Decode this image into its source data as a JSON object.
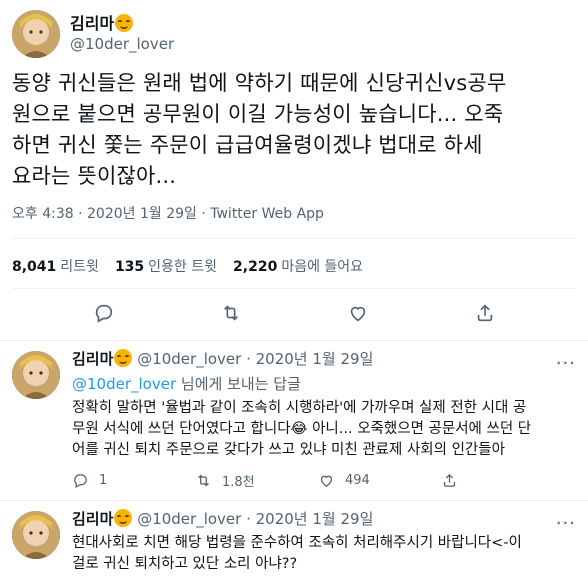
{
  "main_tweet": {
    "display_name": "김리마",
    "handle": "@10der_lover",
    "text": "동양 귀신들은 원래 법에 약하기 때문에 신당귀신vs공무\n원으로 붙으면 공무원이 이길 가능성이 높습니다... 오죽\n하면 귀신 쫓는 주문이 급급여율령이겠냐 법대로 하세\n요라는 뜻이잖아...",
    "meta": "오후 4:38 · 2020년 1월 29일 · Twitter Web App",
    "stats": {
      "retweets_count": "8,041",
      "retweets_label": "리트윗",
      "quotes_count": "135",
      "quotes_label": "인용한 트윗",
      "likes_count": "2,220",
      "likes_label": "마음에 들어요"
    }
  },
  "replies": [
    {
      "display_name": "김리마",
      "handle": "@10der_lover",
      "time": "· 2020년 1월 29일",
      "replying_to_handle": "@10der_lover",
      "replying_suffix": " 님에게 보내는 답글",
      "text": "정확히 말하면 '율법과 같이 조속히 시행하라'에 가까우며 실제 전한 시대 공\n무원 서식에 쓰던 단어였다고 합니다😂 아니... 오죽했으면 공문서에 쓰던 단\n어를 귀신 퇴치 주문으로 갖다가 쓰고 있냐 미친 관료제 사회의 인간들아",
      "reply_count": "1",
      "retweet_count": "1.8천",
      "like_count": "494"
    },
    {
      "display_name": "김리마",
      "handle": "@10der_lover",
      "time": "· 2020년 1월 29일",
      "text": "현대사회로 치면 해당 법령을 준수하여 조속히 처리해주시기 바랍니다<-이\n걸로 귀신 퇴치하고 있단 소리 아냐??"
    }
  ],
  "colors": {
    "text": "#0f1419",
    "secondary": "#536471",
    "link": "#1d9bf0",
    "divider": "#eff3f4"
  },
  "icons": [
    "reply-icon",
    "retweet-icon",
    "like-icon",
    "share-icon",
    "more-icon",
    "smiling-face-emoji"
  ]
}
